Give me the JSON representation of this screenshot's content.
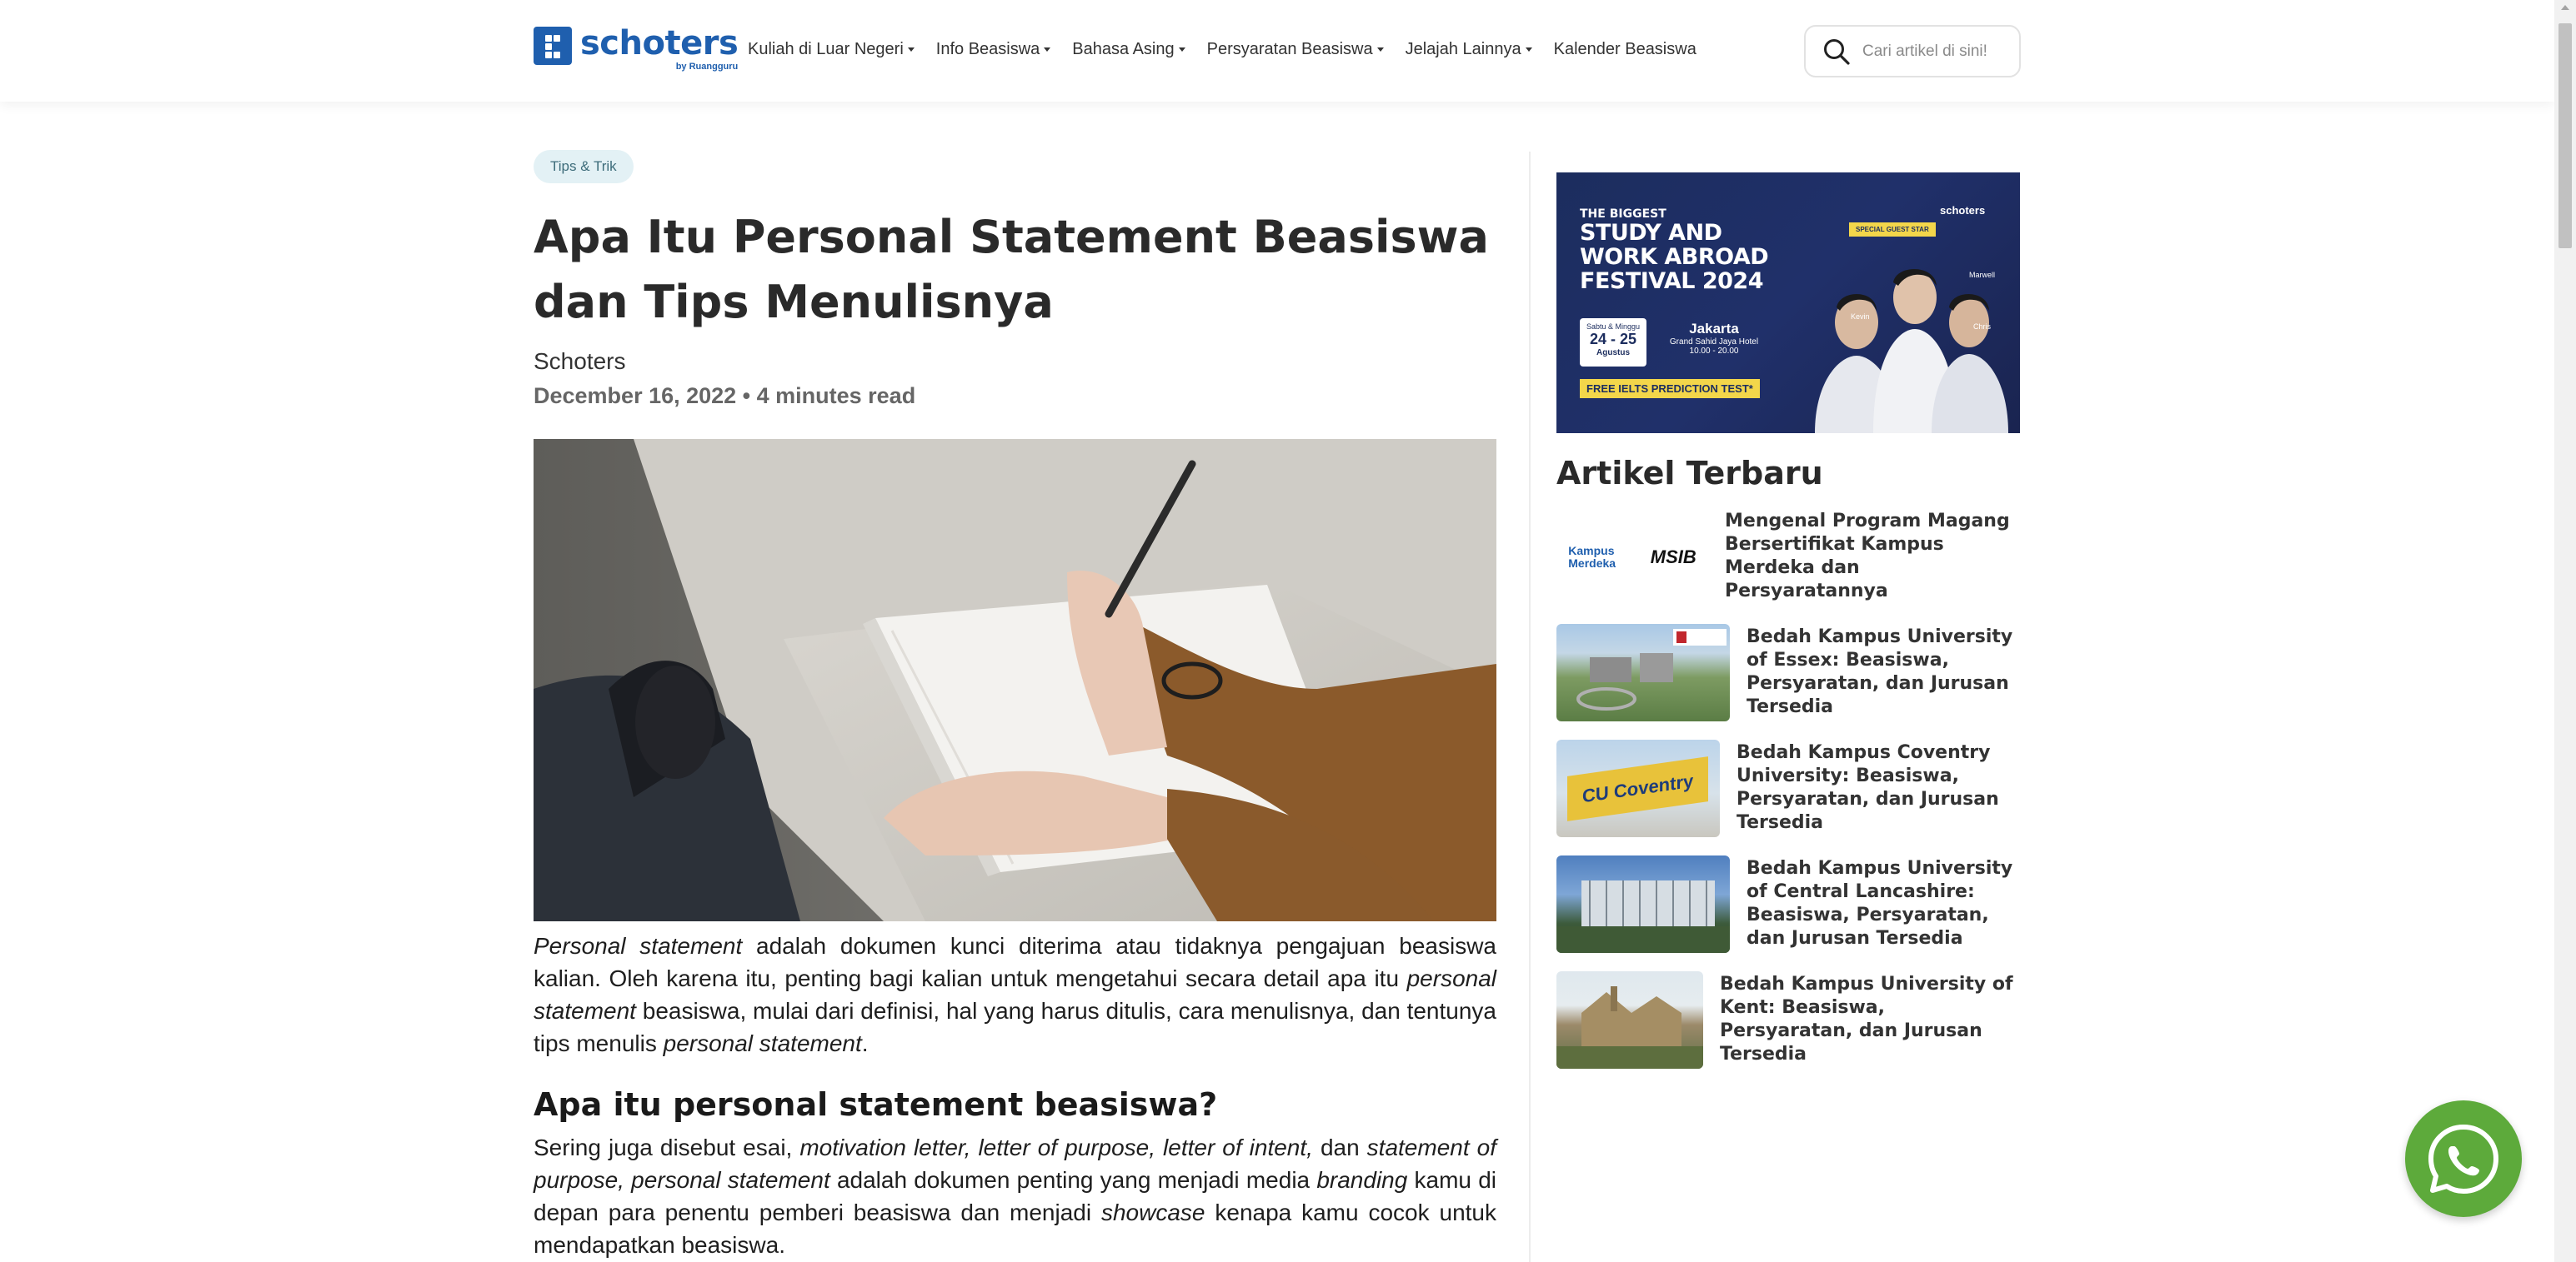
{
  "header": {
    "logo_word": "schoters",
    "logo_sub": "by Ruangguru",
    "nav": [
      {
        "label": "Kuliah di Luar Negeri",
        "caret": true
      },
      {
        "label": "Info Beasiswa",
        "caret": true
      },
      {
        "label": "Bahasa Asing",
        "caret": true
      },
      {
        "label": "Persyaratan Beasiswa",
        "caret": true
      },
      {
        "label": "Jelajah Lainnya",
        "caret": true
      },
      {
        "label": "Kalender Beasiswa",
        "caret": false
      }
    ],
    "search_placeholder": "Cari artikel di sini!"
  },
  "article": {
    "tag": "Tips & Trik",
    "title": "Apa Itu Personal Statement Beasiswa dan Tips Menulisnya",
    "author": "Schoters",
    "meta": "December 16, 2022 • 4 minutes read",
    "p1": [
      {
        "t": "Personal statement",
        "i": true
      },
      {
        "t": " adalah dokumen kunci diterima atau tidaknya pengajuan beasiswa kalian. Oleh karena itu, penting bagi kalian untuk mengetahui secara detail apa itu ",
        "i": false
      },
      {
        "t": "personal statement",
        "i": true
      },
      {
        "t": " beasiswa, mulai dari definisi, hal yang harus ditulis, cara menulisnya, dan tentunya tips menulis ",
        "i": false
      },
      {
        "t": "personal statement",
        "i": true
      },
      {
        "t": ".",
        "i": false
      }
    ],
    "h2": "Apa itu personal statement beasiswa?",
    "p2": [
      {
        "t": "Sering juga disebut esai, ",
        "i": false
      },
      {
        "t": "motivation letter, letter of purpose, letter of intent,",
        "i": true
      },
      {
        "t": " dan ",
        "i": false
      },
      {
        "t": "statement of purpose, personal statement",
        "i": true
      },
      {
        "t": " adalah dokumen penting yang menjadi media ",
        "i": false
      },
      {
        "t": "branding",
        "i": true
      },
      {
        "t": " kamu di depan para penentu pemberi beasiswa dan menjadi ",
        "i": false
      },
      {
        "t": "showcase",
        "i": true
      },
      {
        "t": " kenapa kamu cocok untuk mendapatkan beasiswa.",
        "i": false
      }
    ]
  },
  "banner": {
    "line1": "THE BIGGEST",
    "line2": "STUDY AND",
    "line3": "WORK ABROAD",
    "line4": "FESTIVAL 2024",
    "brand": "schoters",
    "special": "SPECIAL GUEST STAR",
    "day": "Sabtu & Minggu",
    "dates": "24 - 25",
    "month": "Agustus",
    "city": "Jakarta",
    "venue": "Grand Sahid Jaya Hotel",
    "time": "10.00 - 20.00",
    "promo": "FREE IELTS PREDICTION TEST*",
    "guests": [
      "Marwell",
      "Kevin",
      "Chris"
    ]
  },
  "sidebar": {
    "title": "Artikel Terbaru",
    "items": [
      {
        "title": "Mengenal Program Magang Bersertifikat Kampus Merdeka dan Persyaratannya",
        "thumb_text_a": "Kampus Merdeka",
        "thumb_text_b": "MSIB"
      },
      {
        "title": "Bedah Kampus University of Essex: Beasiswa, Persyaratan, dan Jurusan Tersedia"
      },
      {
        "title": "Bedah Kampus Coventry University: Beasiswa, Persyaratan, dan Jurusan Tersedia",
        "thumb_text_a": "CU Coventry"
      },
      {
        "title": "Bedah Kampus University of Central Lancashire: Beasiswa, Persyaratan, dan Jurusan Tersedia"
      },
      {
        "title": "Bedah Kampus University of Kent: Beasiswa, Persyaratan, dan Jurusan Tersedia"
      }
    ]
  },
  "colors": {
    "brand": "#1f5fae",
    "whatsapp": "#5daa3b",
    "tag_bg": "#e3f1f5"
  }
}
